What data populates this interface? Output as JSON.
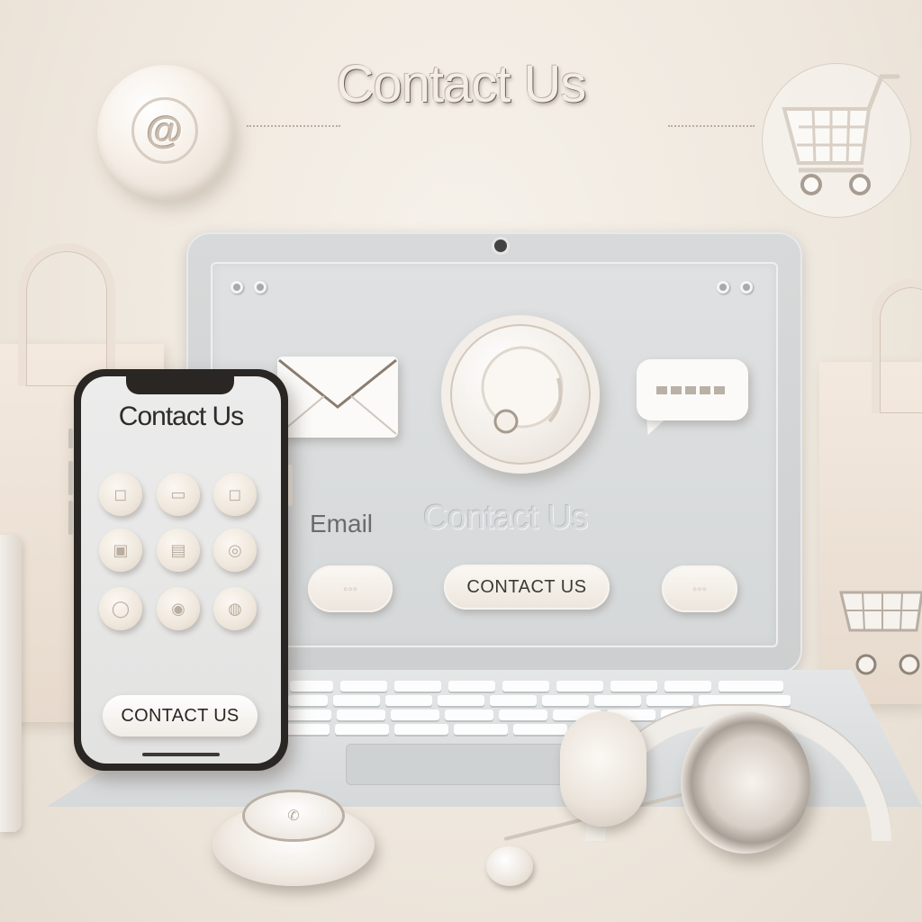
{
  "header": {
    "title": "Contact Us"
  },
  "laptop": {
    "email_label": "Email",
    "screen_title": "Contact Us",
    "primary_button": "CONTACT US",
    "icons": [
      "envelope-icon",
      "headset-icon",
      "chat-bubble-icon"
    ]
  },
  "phone": {
    "title": "Contact Us",
    "cta_button": "CONTACT US",
    "apps": [
      "app-icon-1",
      "app-icon-2",
      "app-icon-3",
      "app-icon-4",
      "app-icon-5",
      "app-icon-6",
      "app-icon-7",
      "app-icon-8",
      "app-icon-9"
    ]
  },
  "decor": {
    "top_left_icon": "at-sign-icon",
    "top_right_icon": "shopping-cart-icon",
    "at_symbol": "@"
  },
  "colors": {
    "background": "#eee7dd",
    "accent": "#f3ede6",
    "text_dark": "#2e2b28"
  }
}
